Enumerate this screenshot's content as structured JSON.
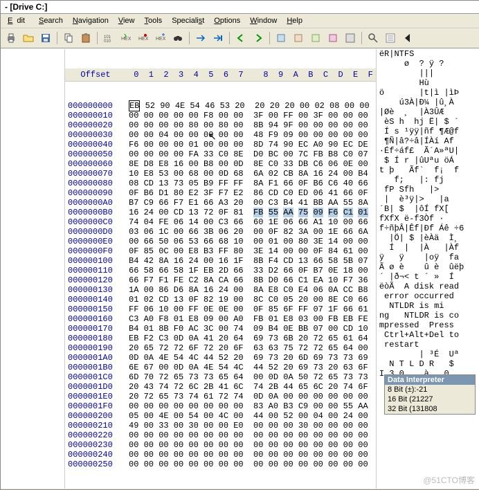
{
  "title": "- [Drive C:]",
  "menus": [
    "Edit",
    "Search",
    "Navigation",
    "View",
    "Tools",
    "Specialist",
    "Options",
    "Window",
    "Help"
  ],
  "header": {
    "offset_label": "Offset",
    "cols": [
      "0",
      "1",
      "2",
      "3",
      "4",
      "5",
      "6",
      "7",
      "8",
      "9",
      "A",
      "B",
      "C",
      "D",
      "E",
      "F"
    ]
  },
  "highlight": {
    "row": 11,
    "start": 8,
    "end": 15
  },
  "rows": [
    {
      "off": "000000000",
      "hex": [
        "EB",
        "52",
        "90",
        "4E",
        "54",
        "46",
        "53",
        "20",
        "20",
        "20",
        "20",
        "00",
        "02",
        "08",
        "00",
        "00"
      ],
      "ascii": "ëR|NTFS"
    },
    {
      "off": "000000010",
      "hex": [
        "00",
        "00",
        "00",
        "00",
        "00",
        "F8",
        "00",
        "00",
        "3F",
        "00",
        "FF",
        "00",
        "3F",
        "00",
        "00",
        "00"
      ],
      "ascii": "     ø  ? ÿ ?"
    },
    {
      "off": "000000020",
      "hex": [
        "00",
        "00",
        "00",
        "00",
        "80",
        "00",
        "80",
        "00",
        "8B",
        "94",
        "9F",
        "00",
        "00",
        "00",
        "00",
        "00"
      ],
      "ascii": "        |||"
    },
    {
      "off": "000000030",
      "hex": [
        "00",
        "00",
        "04",
        "00",
        "00",
        "00",
        "00",
        "00",
        "48",
        "F9",
        "09",
        "00",
        "00",
        "00",
        "00",
        "00"
      ],
      "ascii": "        Hù"
    },
    {
      "off": "000000040",
      "hex": [
        "F6",
        "00",
        "00",
        "00",
        "01",
        "00",
        "00",
        "00",
        "8D",
        "74",
        "90",
        "EC",
        "A0",
        "90",
        "EC",
        "DE"
      ],
      "ascii": "ö       |t|ì |ìÞ"
    },
    {
      "off": "000000050",
      "hex": [
        "00",
        "00",
        "00",
        "00",
        "FA",
        "33",
        "C0",
        "8E",
        "D0",
        "BC",
        "00",
        "7C",
        "FB",
        "B8",
        "C0",
        "07"
      ],
      "ascii": "    ú3À|Ð¼ |û¸À"
    },
    {
      "off": "000000060",
      "hex": [
        "8E",
        "D8",
        "E8",
        "16",
        "00",
        "B8",
        "00",
        "0D",
        "8E",
        "C0",
        "33",
        "DB",
        "C6",
        "06",
        "0E",
        "00"
      ],
      "ascii": "|Øè  ¸  |À3ÛÆ"
    },
    {
      "off": "000000070",
      "hex": [
        "10",
        "E8",
        "53",
        "00",
        "68",
        "00",
        "0D",
        "68",
        "6A",
        "02",
        "CB",
        "8A",
        "16",
        "24",
        "00",
        "B4"
      ],
      "ascii": " èS h  hj Ë| $ ´"
    },
    {
      "off": "000000080",
      "hex": [
        "08",
        "CD",
        "13",
        "73",
        "05",
        "B9",
        "FF",
        "FF",
        "8A",
        "F1",
        "66",
        "0F",
        "B6",
        "C6",
        "40",
        "66"
      ],
      "ascii": " Í s ¹ÿÿ|ñf ¶Æ@f"
    },
    {
      "off": "000000090",
      "hex": [
        "0F",
        "B6",
        "D1",
        "80",
        "E2",
        "3F",
        "F7",
        "E2",
        "86",
        "CD",
        "C0",
        "ED",
        "06",
        "41",
        "66",
        "0F"
      ],
      "ascii": " ¶Ñ|â?÷â|ÍÀí Af"
    },
    {
      "off": "0000000A0",
      "hex": [
        "B7",
        "C9",
        "66",
        "F7",
        "E1",
        "66",
        "A3",
        "20",
        "00",
        "C3",
        "B4",
        "41",
        "BB",
        "AA",
        "55",
        "8A"
      ],
      "ascii": "·Éf÷áf£  Ã´A»ªU|"
    },
    {
      "off": "0000000B0",
      "hex": [
        "16",
        "24",
        "00",
        "CD",
        "13",
        "72",
        "0F",
        "81",
        "FB",
        "55",
        "AA",
        "75",
        "09",
        "F6",
        "C1",
        "01"
      ],
      "ascii": " $ Í r |ûUªu öÁ"
    },
    {
      "off": "0000000C0",
      "hex": [
        "74",
        "04",
        "FE",
        "06",
        "14",
        "00",
        "C3",
        "66",
        "60",
        "1E",
        "06",
        "66",
        "A1",
        "10",
        "00",
        "66"
      ],
      "ascii": "t þ   Ãf`  f¡  f"
    },
    {
      "off": "0000000D0",
      "hex": [
        "03",
        "06",
        "1C",
        "00",
        "66",
        "3B",
        "06",
        "20",
        "00",
        "0F",
        "82",
        "3A",
        "00",
        "1E",
        "66",
        "6A"
      ],
      "ascii": "   f;   |: fj"
    },
    {
      "off": "0000000E0",
      "hex": [
        "00",
        "66",
        "50",
        "06",
        "53",
        "66",
        "68",
        "10",
        "00",
        "01",
        "00",
        "80",
        "3E",
        "14",
        "00",
        "00"
      ],
      "ascii": " fP Sfh   |>"
    },
    {
      "off": "0000000F0",
      "hex": [
        "0F",
        "85",
        "0C",
        "00",
        "E8",
        "B3",
        "FF",
        "80",
        "3E",
        "14",
        "00",
        "00",
        "0F",
        "84",
        "61",
        "00"
      ],
      "ascii": " |  è³ÿ|>   |a"
    },
    {
      "off": "000000100",
      "hex": [
        "B4",
        "42",
        "8A",
        "16",
        "24",
        "00",
        "16",
        "1F",
        "8B",
        "F4",
        "CD",
        "13",
        "66",
        "58",
        "5B",
        "07"
      ],
      "ascii": "´B| $  |ôÍ fX["
    },
    {
      "off": "000000110",
      "hex": [
        "66",
        "58",
        "66",
        "58",
        "1F",
        "EB",
        "2D",
        "66",
        "33",
        "D2",
        "66",
        "0F",
        "B7",
        "0E",
        "18",
        "00"
      ],
      "ascii": "fXfX ë-f3Òf ·"
    },
    {
      "off": "000000120",
      "hex": [
        "66",
        "F7",
        "F1",
        "FE",
        "C2",
        "8A",
        "CA",
        "66",
        "8B",
        "D0",
        "66",
        "C1",
        "EA",
        "10",
        "F7",
        "36"
      ],
      "ascii": "f÷ñþÂ|Êf|Ðf Áê ÷6"
    },
    {
      "off": "000000130",
      "hex": [
        "1A",
        "00",
        "86",
        "D6",
        "8A",
        "16",
        "24",
        "00",
        "8A",
        "E8",
        "C0",
        "E4",
        "06",
        "0A",
        "CC",
        "B8"
      ],
      "ascii": "  |Ö| $ |èÀä  Ì¸"
    },
    {
      "off": "000000140",
      "hex": [
        "01",
        "02",
        "CD",
        "13",
        "0F",
        "82",
        "19",
        "00",
        "8C",
        "C0",
        "05",
        "20",
        "00",
        "8E",
        "C0",
        "66"
      ],
      "ascii": "  Í  |  |À   |Àf"
    },
    {
      "off": "000000150",
      "hex": [
        "FF",
        "06",
        "10",
        "00",
        "FF",
        "0E",
        "0E",
        "00",
        "0F",
        "85",
        "6F",
        "FF",
        "07",
        "1F",
        "66",
        "61"
      ],
      "ascii": "ÿ   ÿ    |oÿ  fa"
    },
    {
      "off": "000000160",
      "hex": [
        "C3",
        "A0",
        "F8",
        "01",
        "E8",
        "09",
        "00",
        "A0",
        "FB",
        "01",
        "E8",
        "03",
        "00",
        "FB",
        "EB",
        "FE"
      ],
      "ascii": "Ã ø è    û è  ûëþ"
    },
    {
      "off": "000000170",
      "hex": [
        "B4",
        "01",
        "8B",
        "F0",
        "AC",
        "3C",
        "00",
        "74",
        "09",
        "B4",
        "0E",
        "BB",
        "07",
        "00",
        "CD",
        "10"
      ],
      "ascii": "´ |ð¬< t ´ »  Í"
    },
    {
      "off": "000000180",
      "hex": [
        "EB",
        "F2",
        "C3",
        "0D",
        "0A",
        "41",
        "20",
        "64",
        "69",
        "73",
        "6B",
        "20",
        "72",
        "65",
        "61",
        "64"
      ],
      "ascii": "ëòÃ  A disk read"
    },
    {
      "off": "000000190",
      "hex": [
        "20",
        "65",
        "72",
        "72",
        "6F",
        "72",
        "20",
        "6F",
        "63",
        "63",
        "75",
        "72",
        "72",
        "65",
        "64",
        "00"
      ],
      "ascii": " error occurred"
    },
    {
      "off": "0000001A0",
      "hex": [
        "0D",
        "0A",
        "4E",
        "54",
        "4C",
        "44",
        "52",
        "20",
        "69",
        "73",
        "20",
        "6D",
        "69",
        "73",
        "73",
        "69"
      ],
      "ascii": "  NTLDR is mi"
    },
    {
      "off": "0000001B0",
      "hex": [
        "6E",
        "67",
        "00",
        "0D",
        "0A",
        "4E",
        "54",
        "4C",
        "44",
        "52",
        "20",
        "69",
        "73",
        "20",
        "63",
        "6F"
      ],
      "ascii": "ng   NTLDR is co"
    },
    {
      "off": "0000001C0",
      "hex": [
        "6D",
        "70",
        "72",
        "65",
        "73",
        "73",
        "65",
        "64",
        "00",
        "0D",
        "0A",
        "50",
        "72",
        "65",
        "73",
        "73"
      ],
      "ascii": "mpressed  Press"
    },
    {
      "off": "0000001D0",
      "hex": [
        "20",
        "43",
        "74",
        "72",
        "6C",
        "2B",
        "41",
        "6C",
        "74",
        "2B",
        "44",
        "65",
        "6C",
        "20",
        "74",
        "6F"
      ],
      "ascii": " Ctrl+Alt+Del to"
    },
    {
      "off": "0000001E0",
      "hex": [
        "20",
        "72",
        "65",
        "73",
        "74",
        "61",
        "72",
        "74",
        "0D",
        "0A",
        "00",
        "00",
        "00",
        "00",
        "00",
        "00"
      ],
      "ascii": " restart"
    },
    {
      "off": "0000001F0",
      "hex": [
        "00",
        "00",
        "00",
        "00",
        "00",
        "00",
        "00",
        "00",
        "83",
        "A0",
        "B3",
        "C9",
        "00",
        "00",
        "55",
        "AA"
      ],
      "ascii": "        | ³É  Uª"
    },
    {
      "off": "000000200",
      "hex": [
        "05",
        "00",
        "4E",
        "00",
        "54",
        "00",
        "4C",
        "00",
        "44",
        "00",
        "52",
        "00",
        "04",
        "00",
        "24",
        "00"
      ],
      "ascii": "  N T L D R   $"
    },
    {
      "off": "000000210",
      "hex": [
        "49",
        "00",
        "33",
        "00",
        "30",
        "00",
        "00",
        "E0",
        "00",
        "00",
        "00",
        "30",
        "00",
        "00",
        "00",
        "00"
      ],
      "ascii": "I 3 0    à   0"
    },
    {
      "off": "000000220",
      "hex": [
        "00",
        "00",
        "00",
        "00",
        "00",
        "00",
        "00",
        "00",
        "00",
        "00",
        "00",
        "00",
        "00",
        "00",
        "00",
        "00"
      ],
      "ascii": ""
    },
    {
      "off": "000000230",
      "hex": [
        "00",
        "00",
        "00",
        "00",
        "00",
        "00",
        "00",
        "00",
        "00",
        "00",
        "00",
        "00",
        "00",
        "00",
        "00",
        "00"
      ],
      "ascii": ""
    },
    {
      "off": "000000240",
      "hex": [
        "00",
        "00",
        "00",
        "00",
        "00",
        "00",
        "00",
        "00",
        "00",
        "00",
        "00",
        "00",
        "00",
        "00",
        "00",
        "00"
      ],
      "ascii": ""
    },
    {
      "off": "000000250",
      "hex": [
        "00",
        "00",
        "00",
        "00",
        "00",
        "00",
        "00",
        "00",
        "00",
        "00",
        "00",
        "00",
        "00",
        "00",
        "00",
        "00"
      ],
      "ascii": ""
    }
  ],
  "data_interpreter": {
    "title": "Data Interpreter",
    "rows": [
      {
        "label": "8 Bit (±):",
        "value": "-21"
      },
      {
        "label": "16 Bit (",
        "value": "21227"
      },
      {
        "label": "32 Bit (",
        "value": "131808"
      }
    ]
  },
  "watermark": "@51CTO博客"
}
